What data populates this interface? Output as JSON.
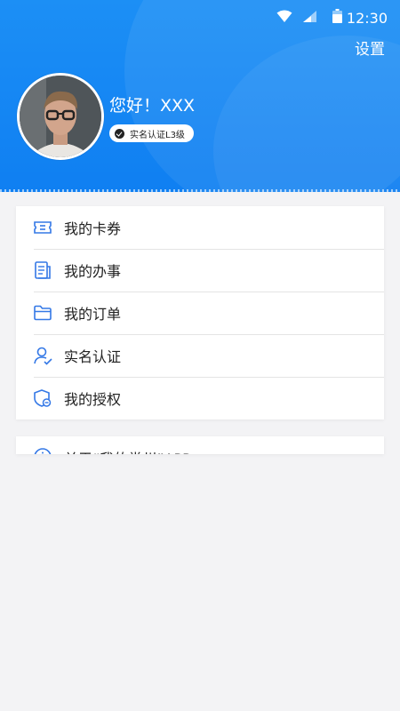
{
  "status_bar": {
    "time": "12:30",
    "icons": [
      "wifi-icon",
      "signal-icon",
      "battery-icon"
    ]
  },
  "header": {
    "settings_label": "设置",
    "greeting": "您好！XXX",
    "badge": "实名认证L3级",
    "colors": {
      "accent": "#1384f3"
    }
  },
  "menu": {
    "items": [
      {
        "label": "我的卡券",
        "icon": "coupon-icon"
      },
      {
        "label": "我的办事",
        "icon": "document-icon"
      },
      {
        "label": "我的订单",
        "icon": "folder-icon"
      },
      {
        "label": "实名认证",
        "icon": "user-verified-icon"
      },
      {
        "label": "我的授权",
        "icon": "shield-icon"
      }
    ]
  },
  "about": {
    "label": "关于“我的常州”APP",
    "icon": "info-icon"
  }
}
